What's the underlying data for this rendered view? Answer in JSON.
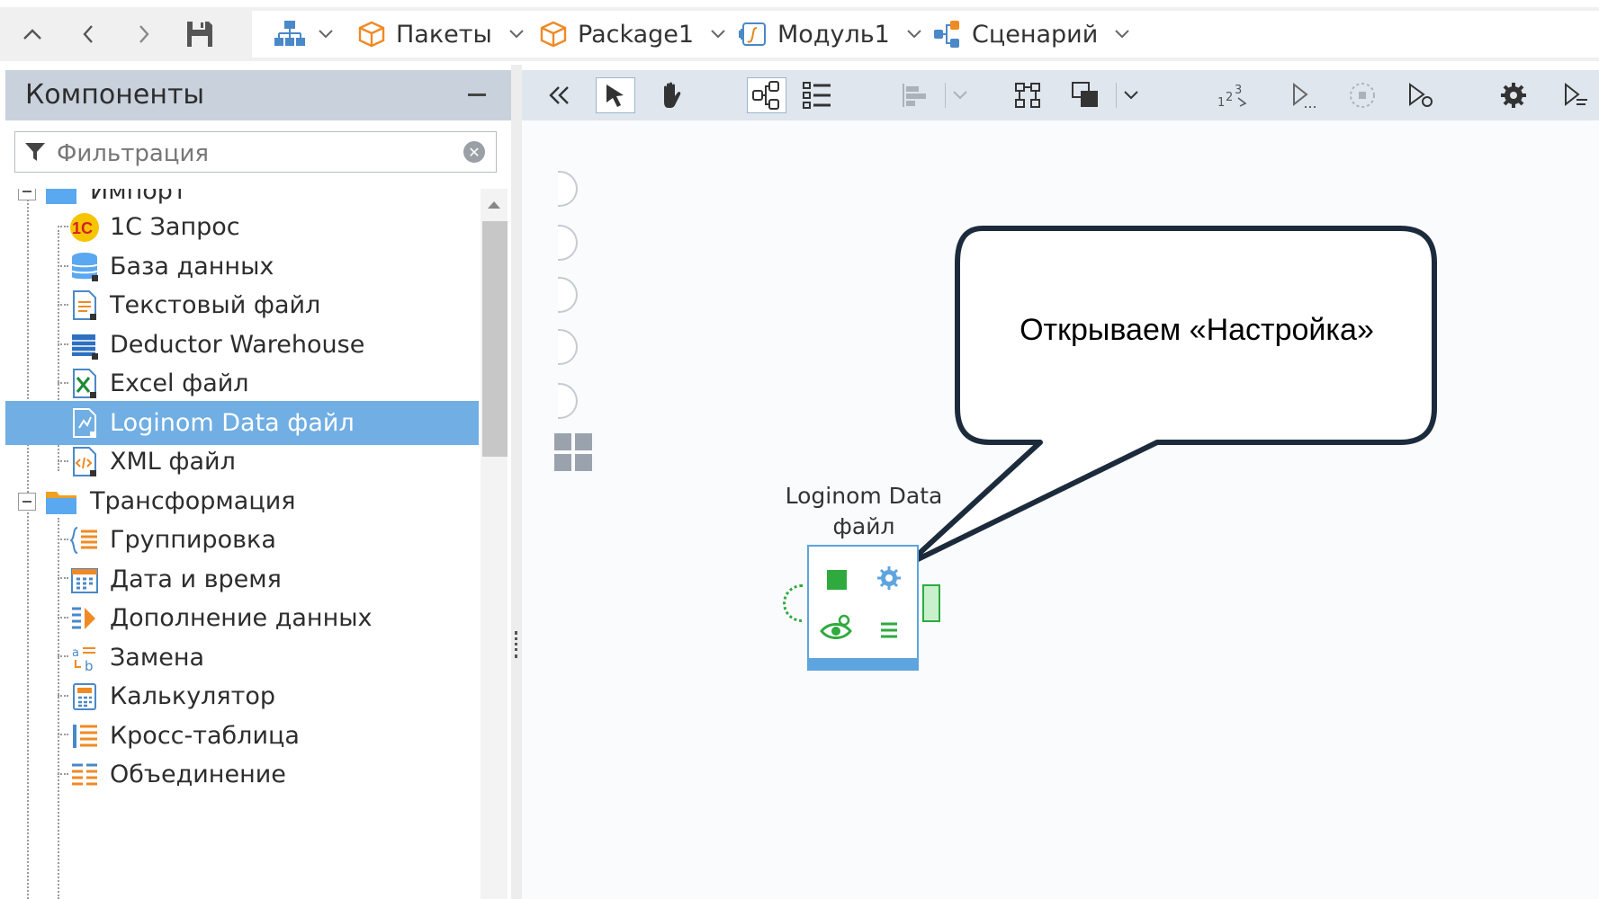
{
  "toolbar": {
    "up_icon": "chevron-up-icon",
    "back_icon": "arrow-back-icon",
    "forward_icon": "arrow-forward-icon",
    "save_icon": "save-icon",
    "breadcrumbs": [
      {
        "label": "Пакеты",
        "icon": "package-icon"
      },
      {
        "label": "Package1",
        "icon": "package-icon"
      },
      {
        "label": "Модуль1",
        "icon": "module-icon"
      },
      {
        "label": "Сценарий",
        "icon": "scenario-icon"
      }
    ]
  },
  "components_panel": {
    "title": "Компоненты",
    "filter_placeholder": "Фильтрация",
    "groups": [
      {
        "label": "Импорт",
        "items": [
          {
            "label": "1С Запрос",
            "icon": "1c-icon"
          },
          {
            "label": "База данных",
            "icon": "database-icon"
          },
          {
            "label": "Текстовый файл",
            "icon": "text-file-icon"
          },
          {
            "label": "Deductor Warehouse",
            "icon": "warehouse-icon"
          },
          {
            "label": "Excel файл",
            "icon": "excel-icon"
          },
          {
            "label": "Loginom Data файл",
            "icon": "loginom-data-icon",
            "selected": true
          },
          {
            "label": "XML файл",
            "icon": "xml-icon"
          }
        ]
      },
      {
        "label": "Трансформация",
        "items": [
          {
            "label": "Группировка",
            "icon": "grouping-icon"
          },
          {
            "label": "Дата и время",
            "icon": "calendar-icon"
          },
          {
            "label": "Дополнение данных",
            "icon": "data-append-icon"
          },
          {
            "label": "Замена",
            "icon": "replace-icon"
          },
          {
            "label": "Калькулятор",
            "icon": "calculator-icon"
          },
          {
            "label": "Кросс-таблица",
            "icon": "cross-table-icon"
          },
          {
            "label": "Объединение",
            "icon": "union-icon"
          }
        ]
      }
    ]
  },
  "canvas": {
    "node_caption": "Loginom Data файл",
    "callout_text": "Открываем «Настройка»"
  },
  "colors": {
    "accent": "#70aee3",
    "node_border": "#5ea4df",
    "port_green": "#2eaa3e",
    "callout_border": "#1c2b3c"
  }
}
